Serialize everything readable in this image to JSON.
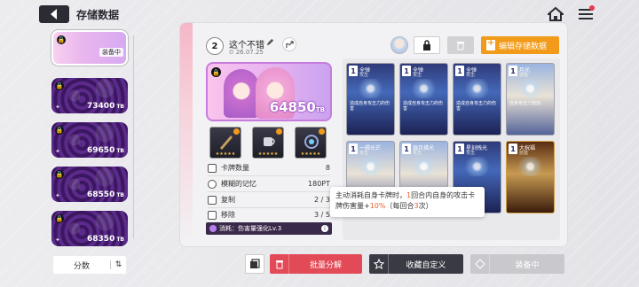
{
  "header": {
    "title": "存储数据"
  },
  "save_slots": [
    {
      "score": "",
      "equipped_label": "装备中",
      "active": true
    },
    {
      "score": "73400",
      "unit": "TB"
    },
    {
      "score": "69650",
      "unit": "TB"
    },
    {
      "score": "68550",
      "unit": "TB"
    },
    {
      "score": "68350",
      "unit": "TB"
    }
  ],
  "sort": {
    "label": "分数"
  },
  "deck": {
    "level": "2",
    "name": "这个不错",
    "date": "26.07.25",
    "score": "64850",
    "score_unit": "TB",
    "edit_button": "编辑存储数据"
  },
  "stats": [
    {
      "label": "卡牌数量",
      "value": "8"
    },
    {
      "label": "模糊的记忆",
      "value": "180PT"
    },
    {
      "label": "复制",
      "value": "2 / 3"
    },
    {
      "label": "移除",
      "value": "3 / 5"
    }
  ],
  "cost": {
    "label": "消耗：伤害量强化Lv.3"
  },
  "tooltip": {
    "pre": "主动消耗自身卡牌时，",
    "n1": "1",
    "mid": "回合内自身的攻击卡牌伤害量+",
    "pct": "10%",
    "post": "（每回合",
    "n2": "3",
    "end": "次）"
  },
  "cards": [
    {
      "cost": "1",
      "name": "全弹",
      "type": "攻击",
      "desc": "造成自身攻击力的伤害"
    },
    {
      "cost": "1",
      "name": "全弹",
      "type": "攻击",
      "desc": "造成自身攻击力的伤害"
    },
    {
      "cost": "1",
      "name": "全弹",
      "type": "攻击",
      "desc": "造成自身攻击力的伤害"
    },
    {
      "cost": "1",
      "name": "月光",
      "type": "技能",
      "desc": "自身攻击力增加"
    },
    {
      "cost": "1",
      "name": "一掷光芒",
      "type": "攻击",
      "desc": ""
    },
    {
      "cost": "1",
      "name": "银月拂光",
      "type": "攻击",
      "desc": ""
    },
    {
      "cost": "1",
      "name": "星刻残光",
      "type": "攻击",
      "desc": ""
    },
    {
      "cost": "1",
      "name": "大祝福",
      "type": "技能",
      "desc": ""
    }
  ],
  "buttons": {
    "dismantle": "批量分解",
    "favorite": "收藏自定义",
    "equipped": "装备中"
  },
  "colors": {
    "accent_orange": "#f29a19",
    "danger_red": "#e24a57",
    "dark": "#3a3a44"
  }
}
